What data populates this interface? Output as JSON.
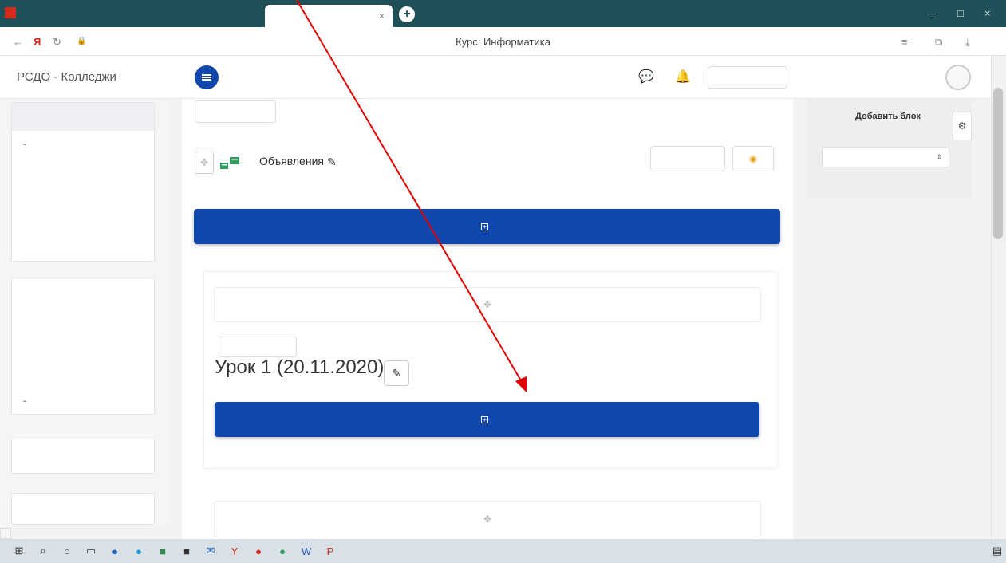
{
  "browser": {
    "tabs": [
      {
        "label": ""
      },
      {
        "label": ""
      },
      {
        "label": "",
        "close": "×"
      }
    ],
    "new_tab": "+",
    "url": "",
    "page_title": "Курс: Информатика",
    "reviews": "",
    "window_controls": [
      "",
      "",
      "–",
      "□",
      "×"
    ]
  },
  "header": {
    "brand": "РСДО - Колледжи",
    "language": "",
    "user_name": ""
  },
  "drawer": {
    "group1": [
      {
        "label": "",
        "icon": "",
        "active": true
      },
      {
        "label": "",
        "icon": "-",
        "bold": true
      },
      {
        "label": "",
        "icon": ""
      },
      {
        "label": "",
        "icon": ""
      },
      {
        "label": "",
        "icon": ""
      },
      {
        "label": "",
        "icon": ""
      }
    ],
    "group2": [
      {
        "label": "",
        "icon": ""
      },
      {
        "label": "",
        "icon": ""
      },
      {
        "label": "",
        "icon": ""
      },
      {
        "label": "",
        "icon": ""
      },
      {
        "label": "",
        "icon": "-",
        "bold": true
      }
    ],
    "admin": {
      "label": "",
      "icon": ""
    },
    "bottom": {
      "label": ""
    }
  },
  "main": {
    "edit_top": "",
    "forum_title": "Объявления",
    "edit_forum": "",
    "add_activity_1": "",
    "section_edit": "",
    "lesson_title": "Урок 1 (20.11.2020)",
    "add_activity_2": ""
  },
  "right_panel": {
    "title": "Добавить блок",
    "select_placeholder": ""
  },
  "status_url": "",
  "taskbar": {
    "tray": "",
    "time": "",
    "date": ""
  },
  "colors": {
    "primary": "#0f47ad",
    "tabbar": "#1f4f57",
    "annotation_arrow": "#e00000"
  }
}
